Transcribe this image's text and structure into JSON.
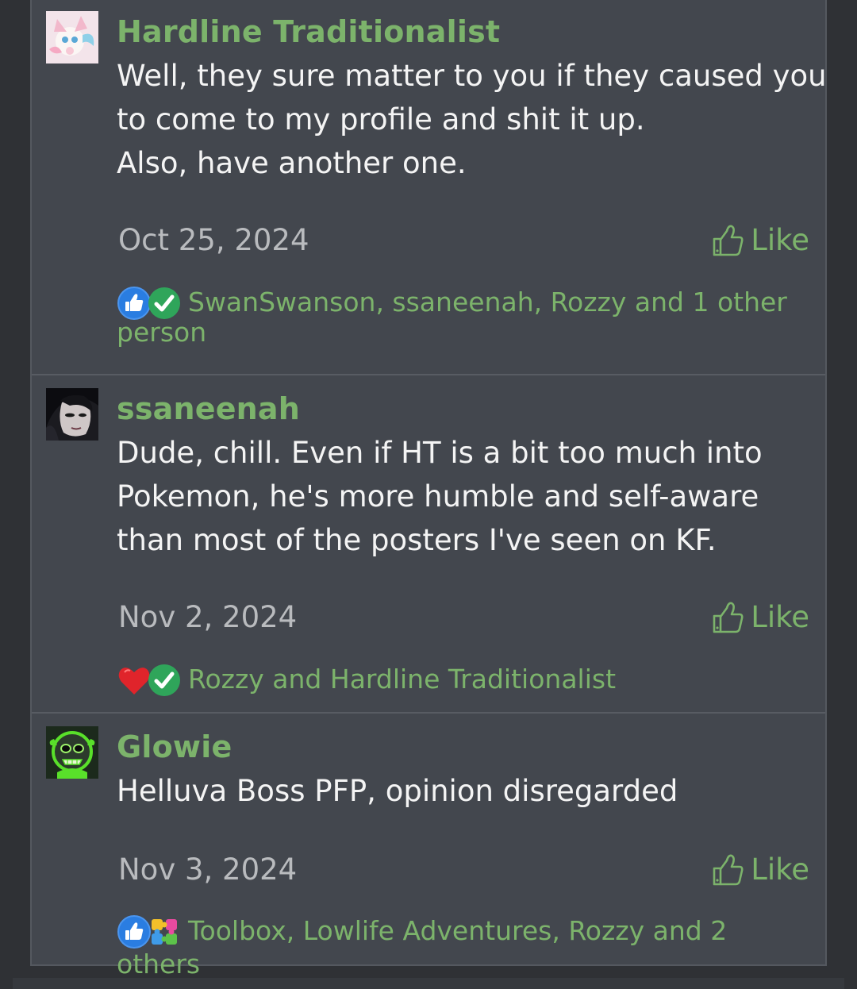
{
  "comments": [
    {
      "username": "Hardline Traditionalist",
      "body_lines": [
        "Well, they sure matter to you if they caused you",
        "to come to my profile and shit it up.",
        "Also, have another one."
      ],
      "date": "Oct 25, 2024",
      "like_label": "Like",
      "reaction_icons": [
        "thumbs-up-reaction-icon",
        "checkmark-reaction-icon"
      ],
      "reaction_users": "SwanSwanson, ssaneenah, Rozzy and 1 other person",
      "reaction_users_line1": "SwanSwanson, ssaneenah, Rozzy and 1 other",
      "reaction_users_line2": "person"
    },
    {
      "username": "ssaneenah",
      "body_lines": [
        "Dude, chill. Even if HT is a bit too much into",
        "Pokemon, he's more humble and self-aware",
        "than most of the posters I've seen on KF."
      ],
      "date": "Nov 2, 2024",
      "like_label": "Like",
      "reaction_icons": [
        "heart-reaction-icon",
        "checkmark-reaction-icon"
      ],
      "reaction_users": "Rozzy and Hardline Traditionalist"
    },
    {
      "username": "Glowie",
      "body_lines": [
        "Helluva Boss PFP, opinion disregarded"
      ],
      "date": "Nov 3, 2024",
      "like_label": "Like",
      "reaction_icons": [
        "thumbs-up-reaction-icon",
        "puzzle-reaction-icon"
      ],
      "reaction_users": "Toolbox, Lowlife Adventures, Rozzy and 2 others"
    }
  ],
  "colors": {
    "background": "#2f3135",
    "panel": "#43474e",
    "username": "#7cb36b",
    "body_text": "#f4f4f4",
    "date": "#b9bbbe",
    "like": "#7cb36b"
  }
}
